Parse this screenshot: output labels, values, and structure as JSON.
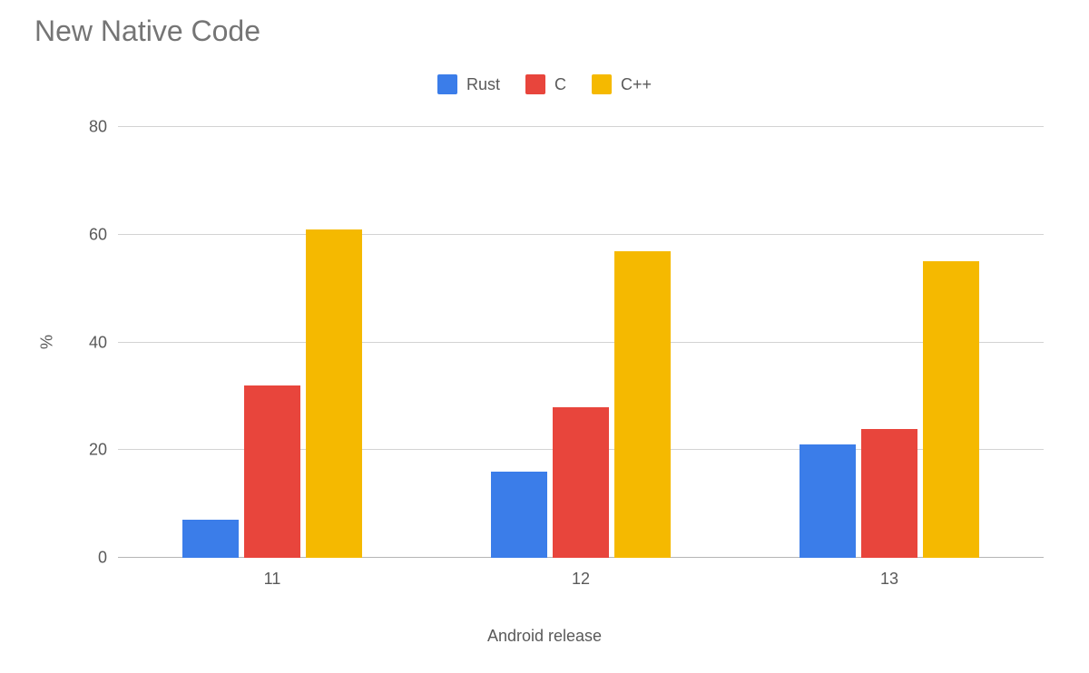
{
  "chart_data": {
    "type": "bar",
    "title": "New Native Code",
    "xlabel": "Android release",
    "ylabel": "%",
    "ylim": [
      0,
      80
    ],
    "yticks": [
      0,
      20,
      40,
      60,
      80
    ],
    "categories": [
      "11",
      "12",
      "13"
    ],
    "series": [
      {
        "name": "Rust",
        "color": "#3b7de9",
        "values": [
          7,
          16,
          21
        ]
      },
      {
        "name": "C",
        "color": "#e8453c",
        "values": [
          32,
          28,
          24
        ]
      },
      {
        "name": "C++",
        "color": "#f5b900",
        "values": [
          61,
          57,
          55
        ]
      }
    ]
  }
}
